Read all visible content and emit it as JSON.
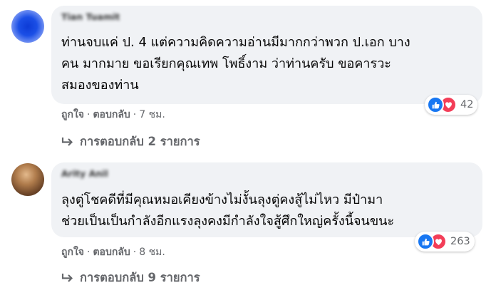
{
  "comments": [
    {
      "author": "Tian Tuamit",
      "lines": [
        "ท่านจบแค่ ป. 4 แต่ความคิดความอ่านมีมากกว่าพวก ป.เอก บาง",
        "คน มากมาย ขอเรียกคุณเทพ โพธิ์งาม ว่าท่านครับ ขอคารวะ",
        "สมองของท่าน"
      ],
      "reaction_count": "42",
      "like_label": "ถูกใจ",
      "reply_label": "ตอบกลับ",
      "time": "7 ชม.",
      "view_replies": "การตอบกลับ 2 รายการ"
    },
    {
      "author": "Arity Anil",
      "lines": [
        "ลุงตู่โชคดีที่มีคุณหมอเคียงข้างไม่งั้นลุงตู่คงสู้ไม่ไหว มีป๋ามา",
        "ช่วยเป็นเป็นกำลังอีกแรงลุงคงมีกำลังใจสู้ศึกใหญ่ครั้งนี้จนขนะ"
      ],
      "reaction_count": "263",
      "like_label": "ถูกใจ",
      "reply_label": "ตอบกลับ",
      "time": "8 ชม.",
      "view_replies": "การตอบกลับ 9 รายการ"
    }
  ],
  "colors": {
    "bubble": "#f0f2f5",
    "secondary_text": "#65676b",
    "like_blue": "#1877f2",
    "love_red": "#f33e58"
  },
  "icons": [
    "like-icon",
    "love-icon",
    "reply-arrow-icon"
  ]
}
